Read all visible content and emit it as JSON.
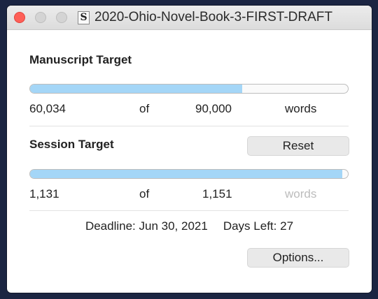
{
  "window": {
    "title": "2020-Ohio-Novel-Book-3-FIRST-DRAFT",
    "doc_icon_letter": "S"
  },
  "manuscript": {
    "heading": "Manuscript Target",
    "current": "60,034",
    "of_label": "of",
    "target": "90,000",
    "unit": "words",
    "progress_fraction": 0.667
  },
  "session": {
    "heading": "Session Target",
    "reset_label": "Reset",
    "current": "1,131",
    "of_label": "of",
    "target": "1,151",
    "unit": "words",
    "progress_fraction": 0.983
  },
  "footer": {
    "deadline_label": "Deadline:",
    "deadline_value": "Jun 30, 2021",
    "days_left_label": "Days Left:",
    "days_left_value": "27",
    "options_label": "Options..."
  },
  "colors": {
    "progress_fill": "#a4d6f7",
    "close_button": "#fe5f57"
  }
}
